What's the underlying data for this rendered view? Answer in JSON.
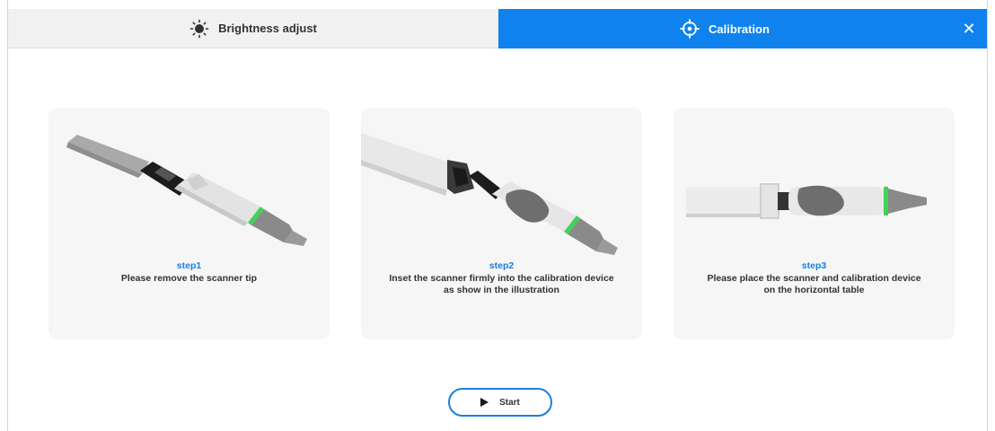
{
  "tabs": {
    "brightness": {
      "label": "Brightness adjust",
      "icon": "brightness-icon"
    },
    "calibration": {
      "label": "Calibration",
      "icon": "crosshair-icon",
      "active": true
    }
  },
  "close": {
    "symbol": "✕",
    "icon": "close-icon"
  },
  "steps": [
    {
      "label": "step1",
      "text": "Please remove the scanner tip"
    },
    {
      "label": "step2",
      "text": "Inset the scanner firmly into the calibration device as show in the illustration"
    },
    {
      "label": "step3",
      "text": "Please place the scanner and calibration device on the horizontal table"
    }
  ],
  "start": {
    "label": "Start",
    "icon": "play-icon"
  },
  "colors": {
    "accent": "#0f82ee",
    "step_label": "#1a7fe0",
    "card_bg": "#f6f6f6",
    "scanner_ring": "#39d353"
  }
}
